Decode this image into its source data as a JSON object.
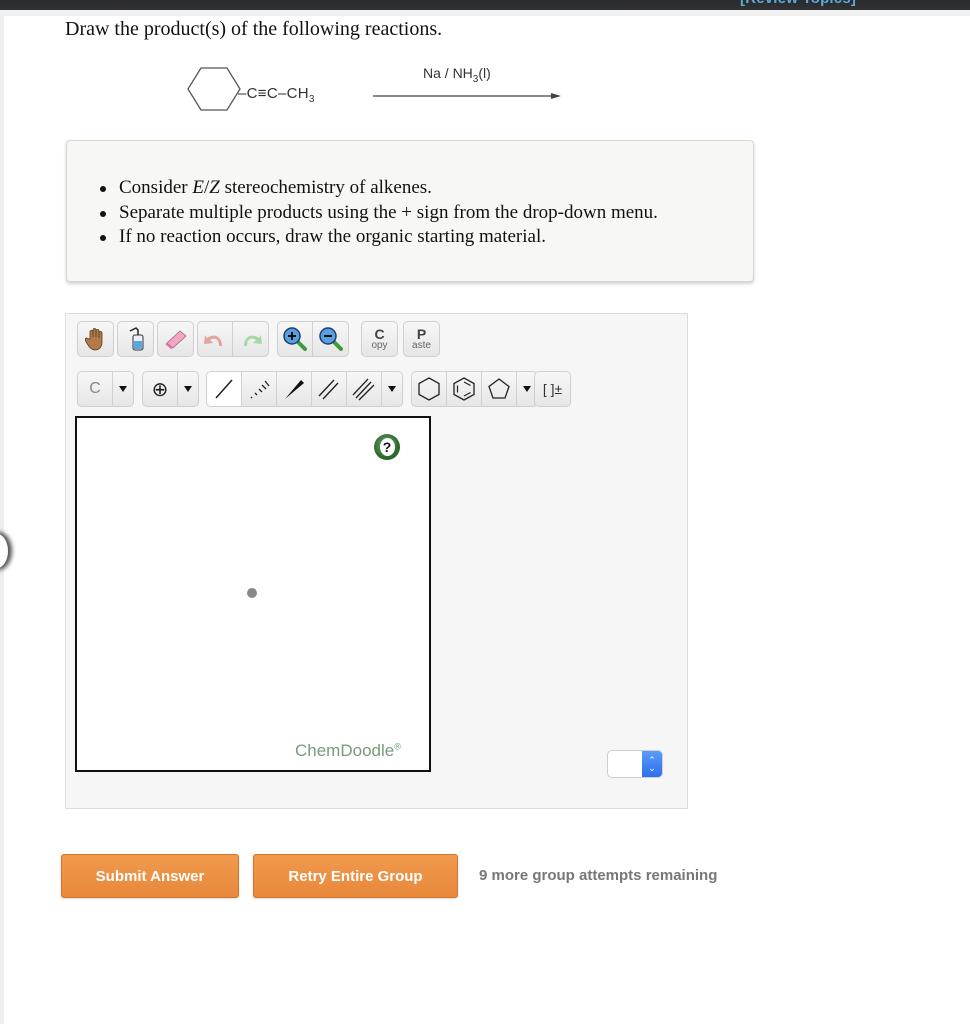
{
  "header": {
    "review_link": "[Review Topics]"
  },
  "question": {
    "title": "Draw the product(s) of the following reactions.",
    "reaction": {
      "reactant_substituent": "–C≡C–CH",
      "reactant_subscript": "3",
      "reactant_ring": "cyclohexane",
      "reagent_prefix": "Na / NH",
      "reagent_subscript": "3",
      "reagent_suffix": "(l)"
    },
    "instructions": [
      {
        "pre": "Consider ",
        "italic": "E",
        "mid": "/",
        "italic2": "Z",
        "post": " stereochemistry of alkenes."
      },
      {
        "text": "Separate multiple products using the + sign from the drop-down menu."
      },
      {
        "text": "If no reaction occurs, draw the organic starting material."
      }
    ]
  },
  "editor": {
    "toolbar_row1": [
      {
        "icon": "hand-icon",
        "label": "Hand"
      },
      {
        "icon": "wash-bottle-icon",
        "label": "Clear"
      },
      {
        "icon": "eraser-icon",
        "label": "Erase"
      },
      {
        "icon": "undo-icon",
        "label": "Undo"
      },
      {
        "icon": "redo-icon",
        "label": "Redo"
      },
      {
        "icon": "zoom-in-icon",
        "label": "Zoom in"
      },
      {
        "icon": "zoom-out-icon",
        "label": "Zoom out"
      }
    ],
    "copy": {
      "big": "C",
      "small": "opy"
    },
    "paste": {
      "big": "P",
      "small": "aste"
    },
    "atom_label": "C",
    "charge_symbol": "⊕",
    "charge_bracket": "[ ]±",
    "watermark": "ChemDoodle",
    "watermark_mark": "®",
    "help_symbol": "?",
    "stepper_value": ""
  },
  "actions": {
    "submit": "Submit Answer",
    "retry": "Retry Entire Group",
    "attempts": "9 more group attempts remaining"
  },
  "colors": {
    "button_orange": "#ec8e40",
    "link_blue": "#5ea9d8",
    "chemdoodle_green": "#7a9a78"
  }
}
